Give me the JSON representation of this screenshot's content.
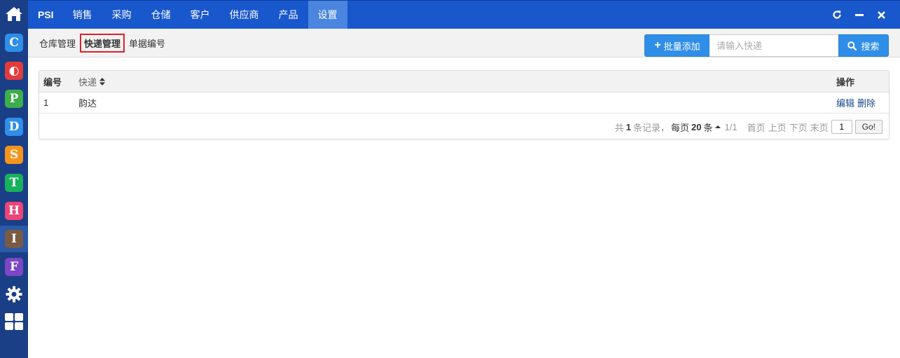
{
  "colors": {
    "sidebar_bg": "#1a3f87",
    "topbar_bg": "#1957cc",
    "active_tab_bg": "#4a86e0",
    "primary_button": "#2f8ee8",
    "highlight_border": "#e0202a"
  },
  "sidebar": {
    "home_icon": "home-icon",
    "apps": [
      {
        "letter": "C",
        "color": "#2f8ee8"
      },
      {
        "letter": "◐",
        "color": "#e23b3b"
      },
      {
        "letter": "P",
        "color": "#3cae4a"
      },
      {
        "letter": "D",
        "color": "#2f8ee8"
      },
      {
        "letter": "S",
        "color": "#f5941d"
      },
      {
        "letter": "T",
        "color": "#17b15c"
      },
      {
        "letter": "H",
        "color": "#ec4477"
      },
      {
        "letter": "I",
        "color": "#7a5a43"
      },
      {
        "letter": "F",
        "color": "#7c46c4"
      }
    ],
    "tools": [
      "gear-icon",
      "grid-icon"
    ]
  },
  "topnav": {
    "items": [
      "PSI",
      "销售",
      "采购",
      "仓储",
      "客户",
      "供应商",
      "产品",
      "设置"
    ],
    "active": "设置",
    "controls": [
      "refresh-icon",
      "minimize-icon",
      "close-icon"
    ]
  },
  "subnav": {
    "tabs": [
      "仓库管理",
      "快递管理",
      "单据编号"
    ],
    "active": "快递管理"
  },
  "toolbar": {
    "add_label": "批量添加",
    "search_placeholder": "请输入快递",
    "search_label": "搜索"
  },
  "table": {
    "columns": [
      "编号",
      "快递",
      "操作"
    ],
    "rows": [
      {
        "id": "1",
        "name": "韵达",
        "actions": [
          "编辑",
          "删除"
        ]
      }
    ]
  },
  "pager": {
    "total_prefix": "共",
    "total": "1",
    "total_suffix": "条记录，",
    "per_page_prefix": "每页",
    "per_page": "20",
    "per_page_suffix": "条",
    "page_info": "1/1",
    "first": "首页",
    "prev": "上页",
    "next": "下页",
    "last": "末页",
    "page_input": "1",
    "go_label": "Go!"
  }
}
